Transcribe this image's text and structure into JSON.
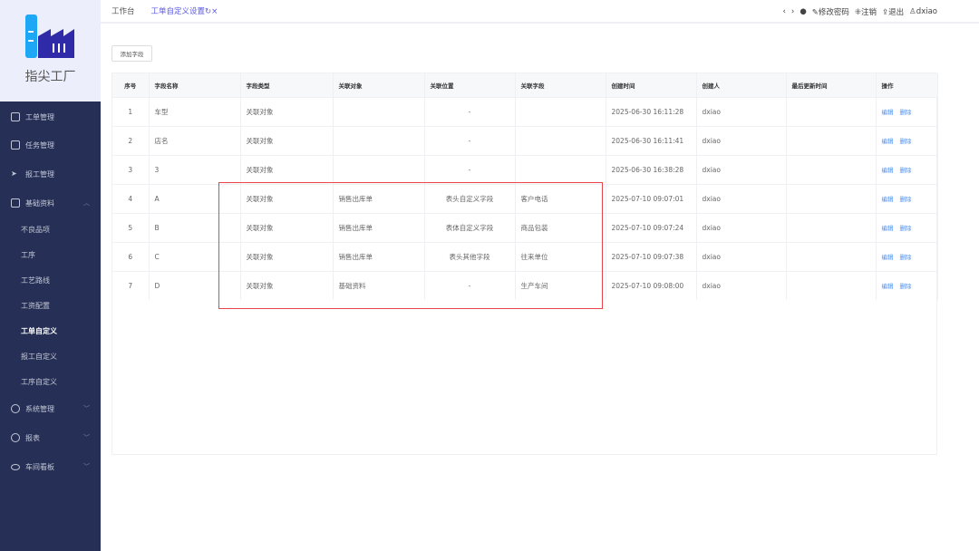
{
  "app": {
    "name": "指尖工厂",
    "colors": {
      "sidebar": "#263056",
      "accent": "#5a57e6",
      "link": "#4a8cf0",
      "highlight": "#e8454a"
    }
  },
  "sidebar": {
    "items": [
      {
        "label": "工单管理",
        "icon": "file-icon"
      },
      {
        "label": "任务管理",
        "icon": "monitor-icon"
      },
      {
        "label": "报工管理",
        "icon": "send-icon"
      },
      {
        "label": "基础资料",
        "icon": "book-icon",
        "expanded": true,
        "children": [
          {
            "label": "不良品项"
          },
          {
            "label": "工序"
          },
          {
            "label": "工艺路线"
          },
          {
            "label": "工资配置"
          },
          {
            "label": "工单自定义",
            "active": true
          },
          {
            "label": "报工自定义"
          },
          {
            "label": "工序自定义"
          }
        ]
      },
      {
        "label": "系统管理",
        "icon": "gear-icon"
      },
      {
        "label": "报表",
        "icon": "pie-chart-icon"
      },
      {
        "label": "车间看板",
        "icon": "eye-icon"
      }
    ]
  },
  "topbar": {
    "tabs": [
      {
        "label": "工作台"
      },
      {
        "label": "工单自定义设置",
        "active": true
      }
    ],
    "actions": {
      "change_password": "修改密码",
      "logout_account": "注销",
      "exit": "退出",
      "user": "dxiao"
    }
  },
  "toolbar": {
    "add_field": "添加字段"
  },
  "table": {
    "columns": [
      "序号",
      "字段名称",
      "字段类型",
      "关联对象",
      "关联位置",
      "关联字段",
      "创建时间",
      "创建人",
      "最后更新时间",
      "操作"
    ],
    "actions": {
      "edit": "编辑",
      "delete": "删除"
    },
    "rows": [
      [
        "1",
        "车型",
        "关联对象",
        "",
        "-",
        "",
        "2025-06-30 16:11:28",
        "dxiao",
        ""
      ],
      [
        "2",
        "店名",
        "关联对象",
        "",
        "-",
        "",
        "2025-06-30 16:11:41",
        "dxiao",
        ""
      ],
      [
        "3",
        "3",
        "关联对象",
        "",
        "-",
        "",
        "2025-06-30 16:38:28",
        "dxiao",
        ""
      ],
      [
        "4",
        "A",
        "关联对象",
        "销售出库单",
        "表头自定义字段",
        "客户电话",
        "2025-07-10 09:07:01",
        "dxiao",
        ""
      ],
      [
        "5",
        "B",
        "关联对象",
        "销售出库单",
        "表体自定义字段",
        "商品包装",
        "2025-07-10 09:07:24",
        "dxiao",
        ""
      ],
      [
        "6",
        "C",
        "关联对象",
        "销售出库单",
        "表头其他字段",
        "往来单位",
        "2025-07-10 09:07:38",
        "dxiao",
        ""
      ],
      [
        "7",
        "D",
        "关联对象",
        "基础资料",
        "-",
        "生产车间",
        "2025-07-10 09:08:00",
        "dxiao",
        ""
      ]
    ]
  }
}
